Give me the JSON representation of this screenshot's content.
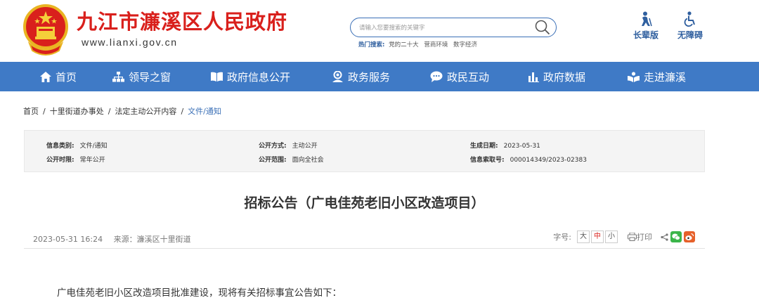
{
  "header": {
    "site_title": "九江市濂溪区人民政府",
    "site_domain": "www.lianxi.gov.cn",
    "search_placeholder": "请输入您要搜索的关键字",
    "hot_label": "热门搜索:",
    "hot_keywords": [
      "党的二十大",
      "营商环境",
      "数字经济"
    ],
    "tools": [
      {
        "label": "长辈版",
        "icon": "elder-icon"
      },
      {
        "label": "无障碍",
        "icon": "accessibility-icon"
      }
    ]
  },
  "nav": {
    "items": [
      {
        "label": "首页",
        "icon": "home-icon"
      },
      {
        "label": "领导之窗",
        "icon": "org-chart-icon"
      },
      {
        "label": "政府信息公开",
        "icon": "book-icon"
      },
      {
        "label": "政务服务",
        "icon": "user-service-icon"
      },
      {
        "label": "政民互动",
        "icon": "chat-icon"
      },
      {
        "label": "政府数据",
        "icon": "bar-chart-icon"
      },
      {
        "label": "走进濂溪",
        "icon": "book-open-icon"
      }
    ]
  },
  "breadcrumb": [
    "首页",
    "十里街道办事处",
    "法定主动公开内容",
    "文件/通知"
  ],
  "info": {
    "category_label": "信息类别:",
    "category_value": "文件/通知",
    "method_label": "公开方式:",
    "method_value": "主动公开",
    "date_label": "生成日期:",
    "date_value": "2023-05-31",
    "period_label": "公开时限:",
    "period_value": "常年公开",
    "scope_label": "公开范围:",
    "scope_value": "面向全社会",
    "index_label": "信息索取号:",
    "index_value": "000014349/2023-02383"
  },
  "article": {
    "title": "招标公告（广电佳苑老旧小区改造项目）",
    "datetime": "2023-05-31 16:24",
    "source": "来源：濂溪区十里街道",
    "font_label": "字号:",
    "font_sizes": [
      "大",
      "中",
      "小"
    ],
    "print_label": "打印",
    "first_paragraph": "广电佳苑老旧小区改造项目批准建设，现将有关招标事宜公告如下："
  },
  "colors": {
    "brand_red": "#d9201c",
    "nav_blue": "#3f7ac6",
    "link_blue": "#3a6fb6",
    "wechat_green": "#3bb54a",
    "weibo_orange": "#e6612b"
  }
}
